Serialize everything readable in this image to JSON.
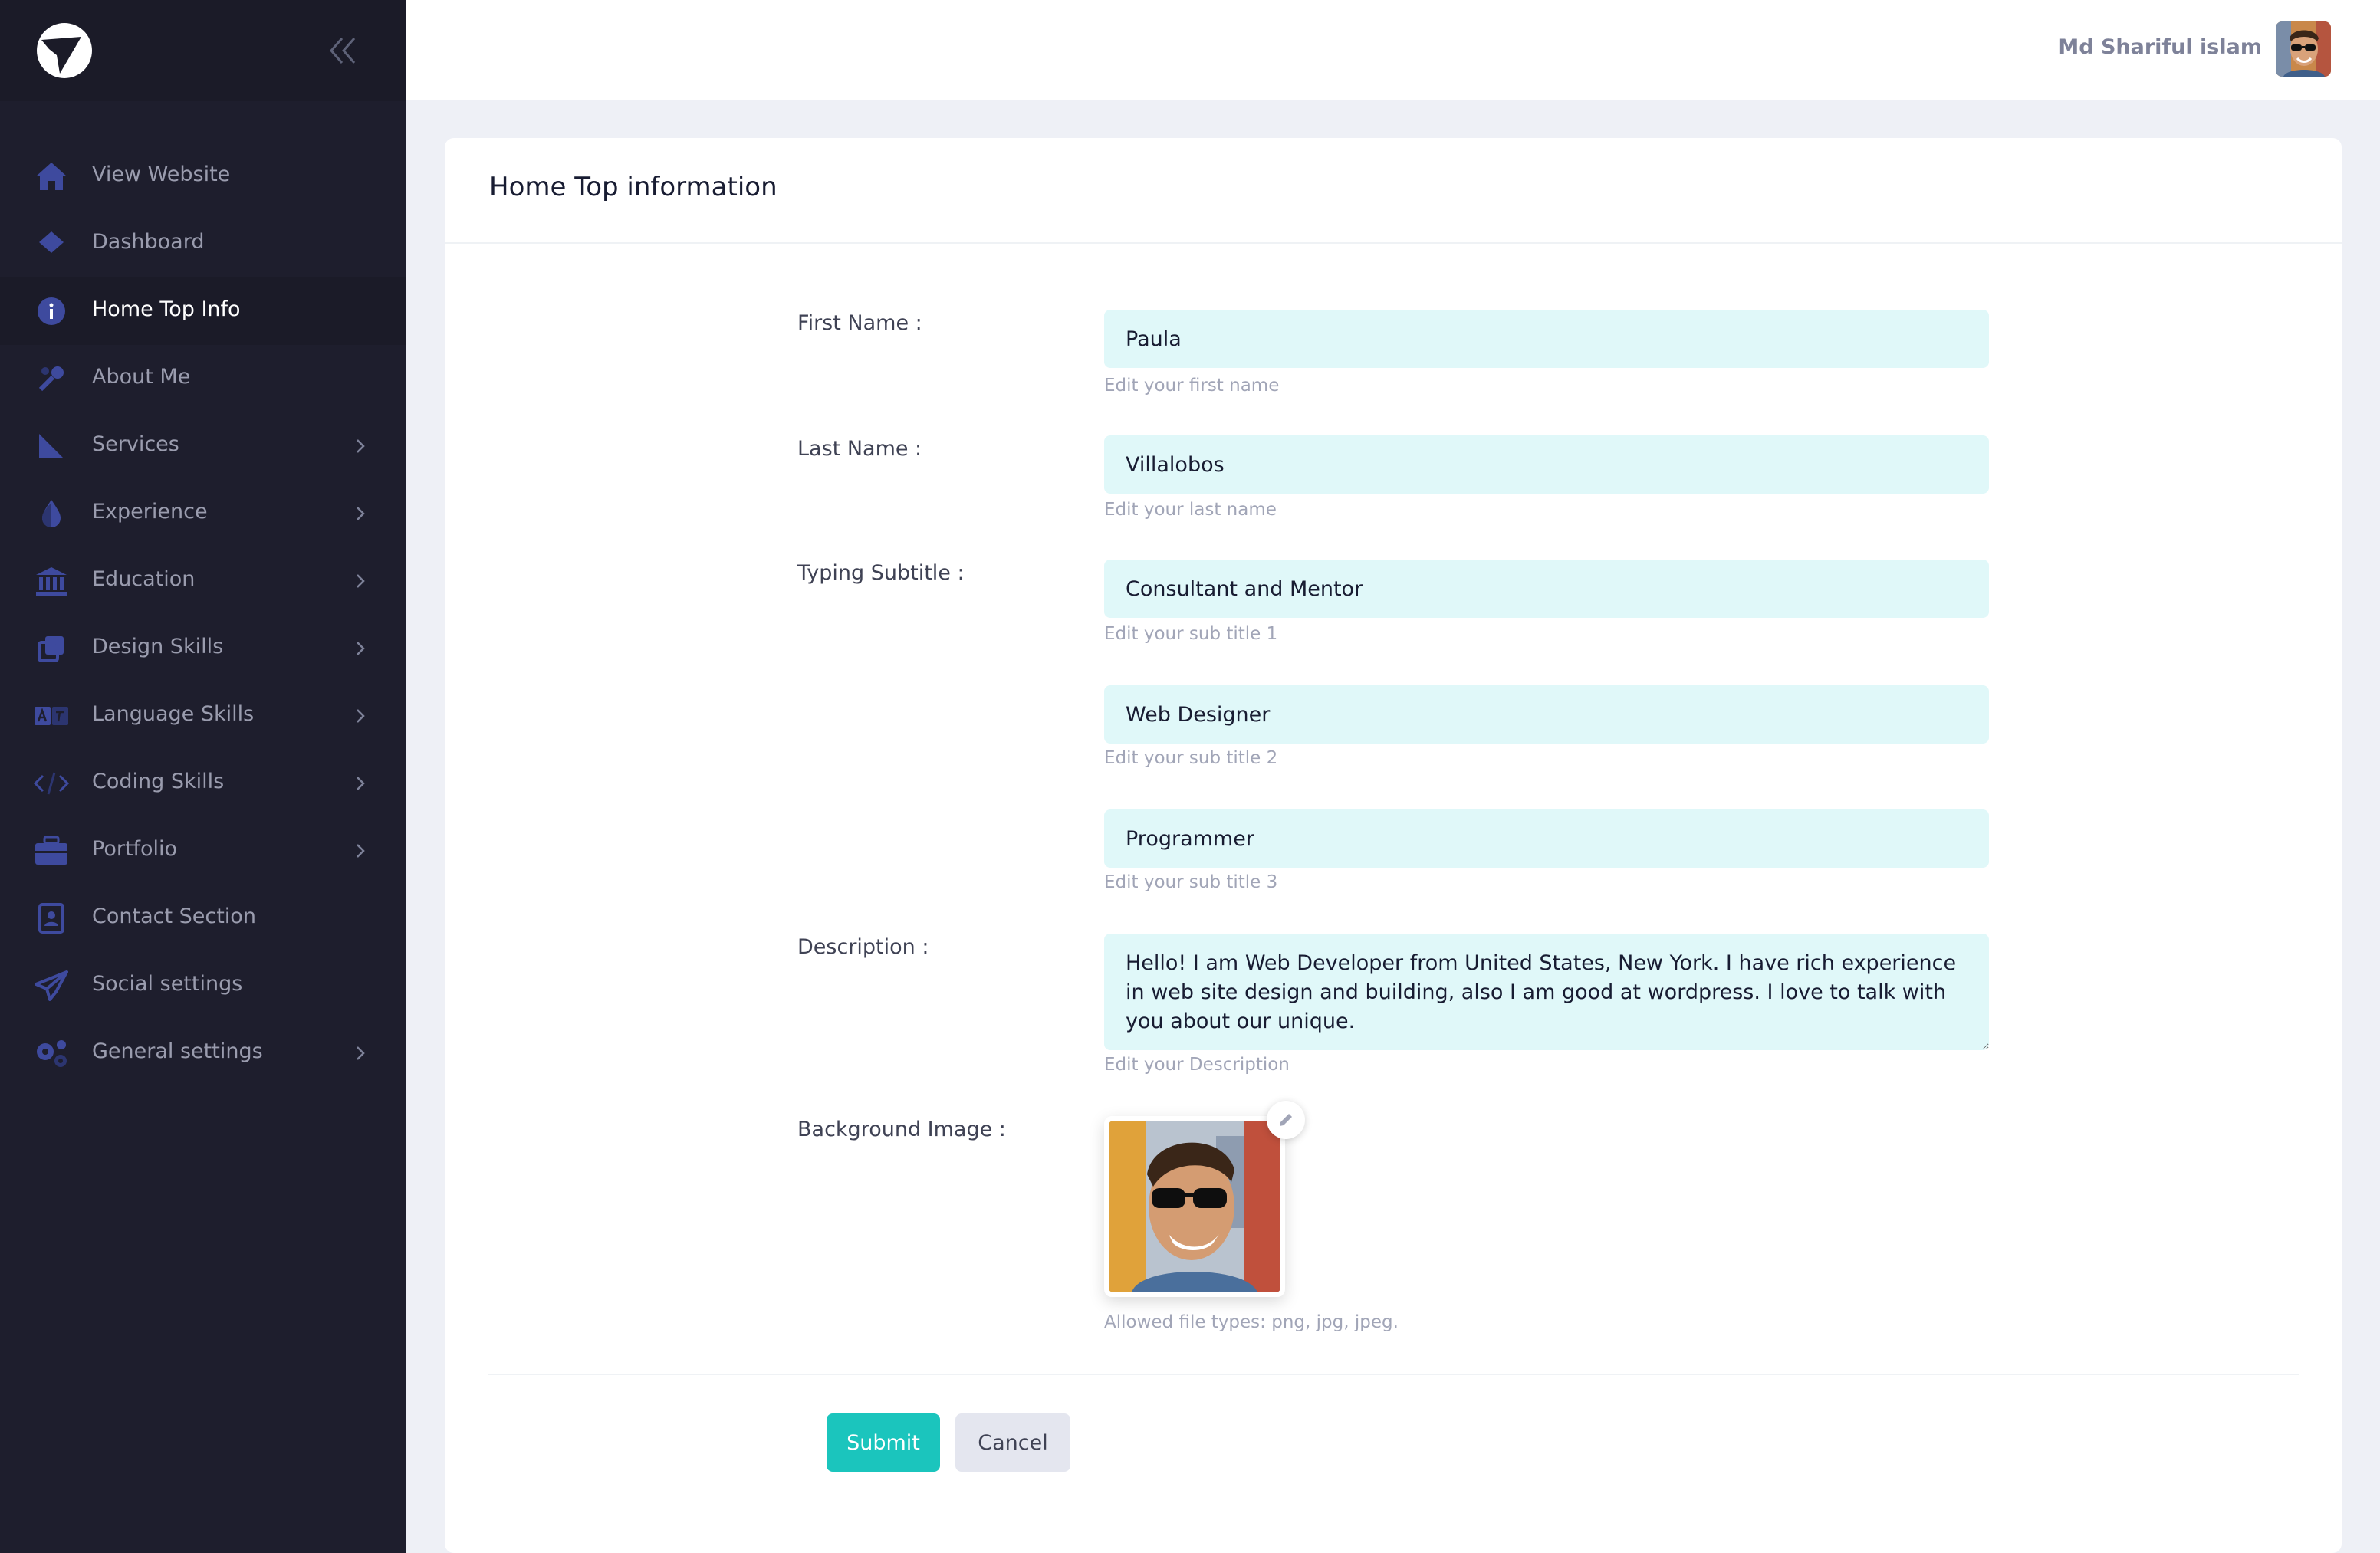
{
  "header": {
    "user_name": "Md Shariful islam"
  },
  "sidebar": {
    "items": [
      {
        "label": "View Website",
        "icon": "home-icon",
        "has_arrow": false,
        "active": false
      },
      {
        "label": "Dashboard",
        "icon": "diamond-icon",
        "has_arrow": false,
        "active": false
      },
      {
        "label": "Home Top Info",
        "icon": "info-icon",
        "has_arrow": false,
        "active": true
      },
      {
        "label": "About Me",
        "icon": "tools-icon",
        "has_arrow": false,
        "active": false
      },
      {
        "label": "Services",
        "icon": "sail-icon",
        "has_arrow": true,
        "active": false
      },
      {
        "label": "Experience",
        "icon": "drop-icon",
        "has_arrow": true,
        "active": false
      },
      {
        "label": "Education",
        "icon": "bank-icon",
        "has_arrow": true,
        "active": false
      },
      {
        "label": "Design Skills",
        "icon": "copy-icon",
        "has_arrow": true,
        "active": false
      },
      {
        "label": "Language Skills",
        "icon": "translate-icon",
        "has_arrow": true,
        "active": false
      },
      {
        "label": "Coding Skills",
        "icon": "code-icon",
        "has_arrow": true,
        "active": false
      },
      {
        "label": "Portfolio",
        "icon": "briefcase-icon",
        "has_arrow": true,
        "active": false
      },
      {
        "label": "Contact Section",
        "icon": "contact-book-icon",
        "has_arrow": false,
        "active": false
      },
      {
        "label": "Social settings",
        "icon": "send-icon",
        "has_arrow": false,
        "active": false
      },
      {
        "label": "General settings",
        "icon": "gears-icon",
        "has_arrow": true,
        "active": false
      }
    ]
  },
  "card": {
    "title": "Home Top information"
  },
  "form": {
    "first_name": {
      "label": "First Name :",
      "value": "Paula",
      "hint": "Edit your first name"
    },
    "last_name": {
      "label": "Last Name :",
      "value": "Villalobos",
      "hint": "Edit your last name"
    },
    "typing_subtitle": {
      "label": "Typing Subtitle :",
      "sub1": {
        "value": "Consultant and Mentor",
        "hint": "Edit your sub title 1"
      },
      "sub2": {
        "value": "Web Designer",
        "hint": "Edit your sub title 2"
      },
      "sub3": {
        "value": "Programmer",
        "hint": "Edit your sub title 3"
      }
    },
    "description": {
      "label": "Description :",
      "value": "Hello! I am Web Developer from United States, New York. I have rich experience in web site design and building, also I am good at wordpress. I love to talk with you about our unique.",
      "hint": "Edit your Description"
    },
    "background_image": {
      "label": "Background Image :",
      "hint": "Allowed file types: png, jpg, jpeg."
    },
    "submit_label": "Submit",
    "cancel_label": "Cancel"
  },
  "colors": {
    "sidebar_bg": "#1e1e2d",
    "accent": "#1bc5bd",
    "field_bg": "#e0f8f9",
    "icon_blue": "#3e4a9e"
  }
}
